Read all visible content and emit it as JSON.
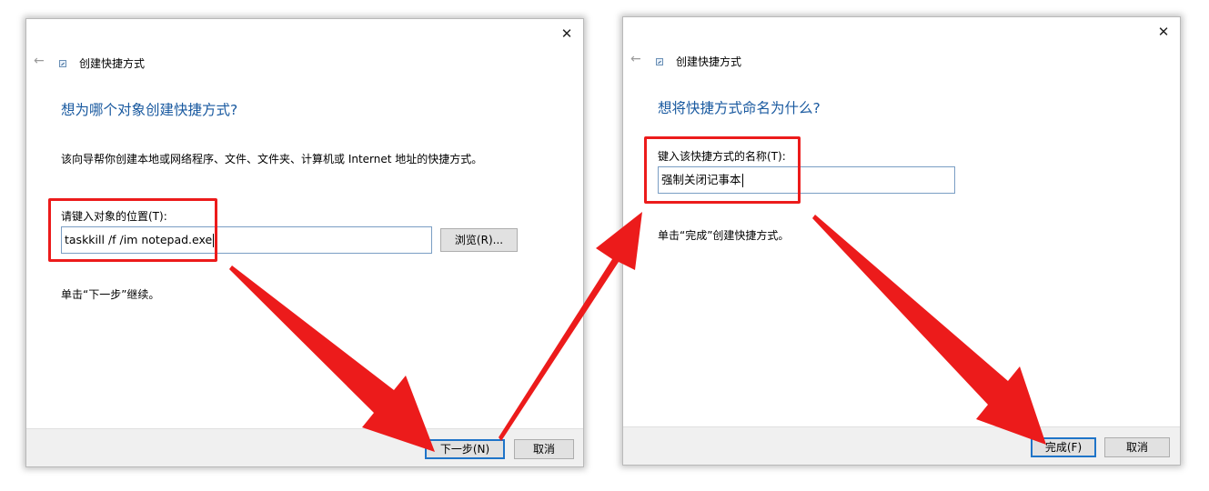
{
  "dialog1": {
    "title": "创建快捷方式",
    "close": "✕",
    "back": "←",
    "heading": "想为哪个对象创建快捷方式?",
    "description": "该向导帮你创建本地或网络程序、文件、文件夹、计算机或 Internet 地址的快捷方式。",
    "location_label": "请键入对象的位置(T):",
    "location_value": "taskkill /f /im notepad.exe",
    "browse_button": "浏览(R)...",
    "hint": "单击“下一步”继续。",
    "next_button": "下一步(N)",
    "cancel_button": "取消"
  },
  "dialog2": {
    "title": "创建快捷方式",
    "close": "✕",
    "back": "←",
    "heading": "想将快捷方式命名为什么?",
    "name_label": "键入该快捷方式的名称(T):",
    "name_value": "强制关闭记事本",
    "hint": "单击“完成”创建快捷方式。",
    "finish_button": "完成(F)",
    "cancel_button": "取消"
  },
  "colors": {
    "annotation_red": "#ec1b1b",
    "heading_blue": "#1a5aa0",
    "default_button_border": "#1f74c8"
  }
}
